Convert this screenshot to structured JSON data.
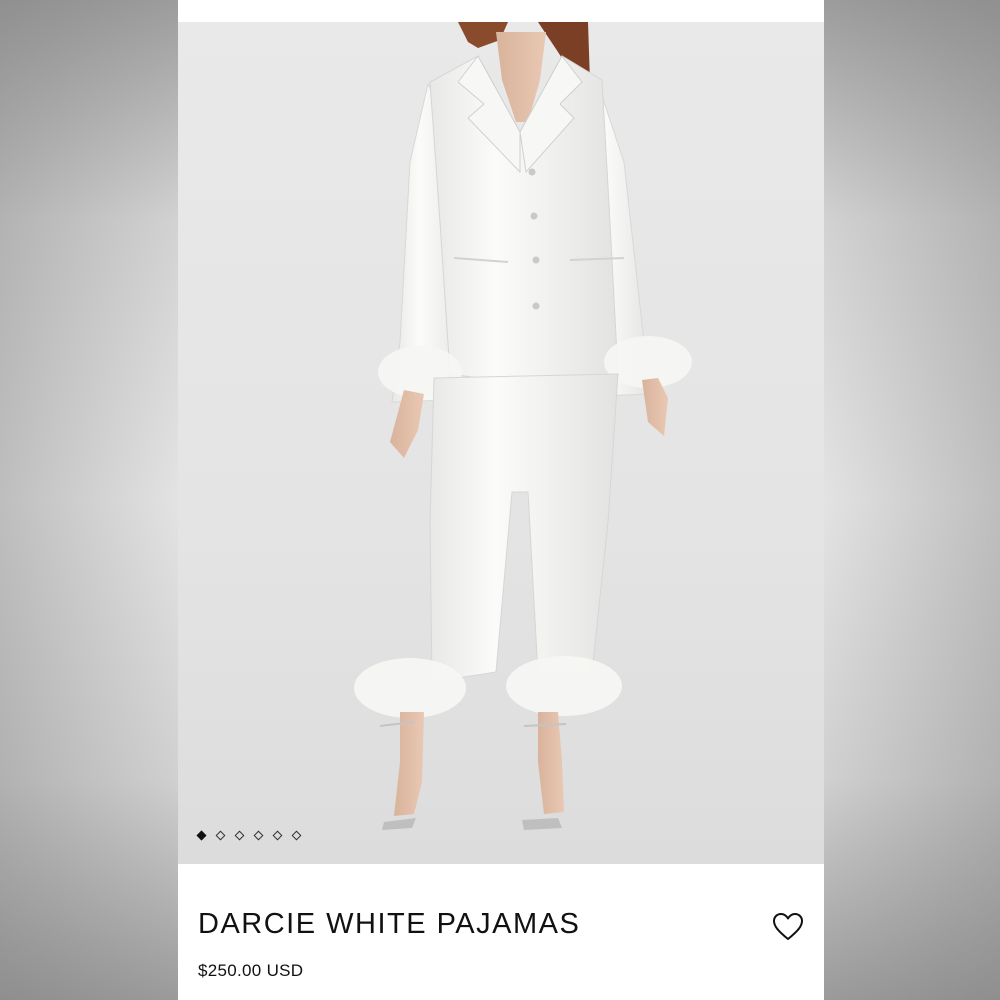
{
  "product": {
    "title": "DARCIE WHITE PAJAMAS",
    "price": "$250.00 USD"
  },
  "gallery": {
    "image_subject": "model wearing white satin pajama set with feather-trim cuffs",
    "image_count": 6,
    "active_index": 0
  },
  "icons": {
    "wishlist": "heart-outline-icon"
  },
  "colors": {
    "text": "#111111",
    "card": "#ffffff",
    "photo_bg": "#e6e6e6"
  }
}
